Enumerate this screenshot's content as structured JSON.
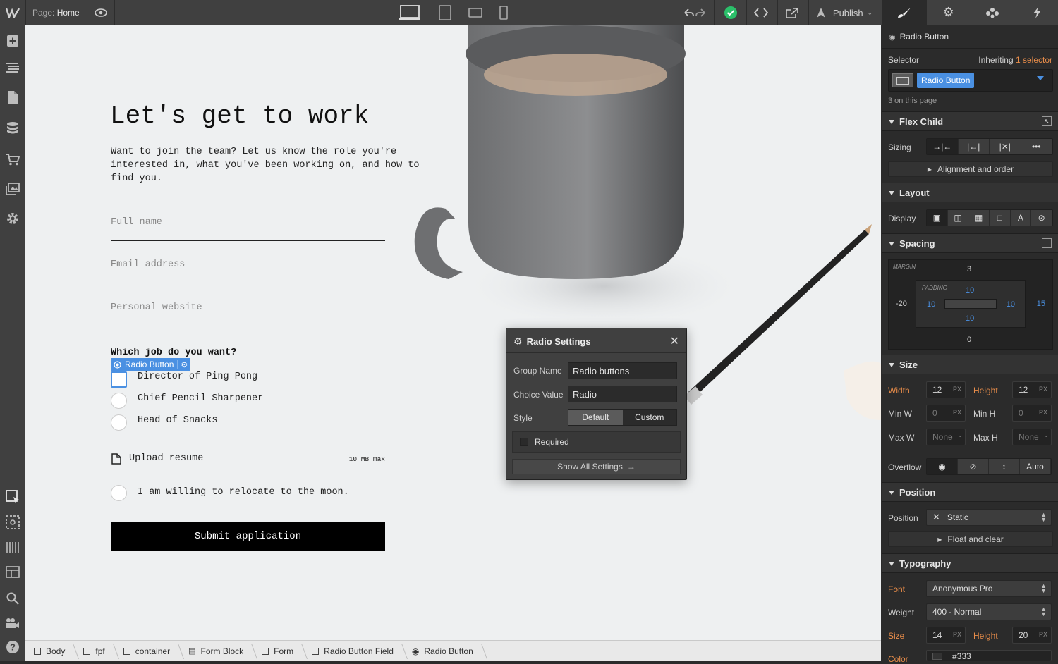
{
  "topbar": {
    "page_label": "Page:",
    "page_name": "Home",
    "publish_label": "Publish"
  },
  "canvas": {
    "heading": "Let's get to work",
    "intro": "Want to join the team? Let us know the role you're interested in, what you've been working on, and how to find you.",
    "fields": [
      {
        "placeholder": "Full name"
      },
      {
        "placeholder": "Email address"
      },
      {
        "placeholder": "Personal website"
      }
    ],
    "question": "Which job do you want?",
    "selection_tag": "Radio Button",
    "options": [
      "Director of Ping Pong",
      "Chief Pencil Sharpener",
      "Head of Snacks"
    ],
    "upload_label": "Upload resume",
    "upload_limit": "10 MB max",
    "relocate_label": "I am willing to relocate to the moon.",
    "submit_label": "Submit application"
  },
  "modal": {
    "title": "Radio Settings",
    "group_name_label": "Group Name",
    "group_name_value": "Radio buttons",
    "choice_value_label": "Choice Value",
    "choice_value_value": "Radio",
    "style_label": "Style",
    "style_options": [
      "Default",
      "Custom"
    ],
    "required_label": "Required",
    "show_all_label": "Show All Settings"
  },
  "breadcrumb": [
    "Body",
    "fpf",
    "container",
    "Form Block",
    "Form",
    "Radio Button Field",
    "Radio Button"
  ],
  "panel": {
    "element_type": "Radio Button",
    "selector_label": "Selector",
    "inheriting_label": "Inheriting",
    "inheriting_link": "1 selector",
    "selector_chip": "Radio Button",
    "on_page": "3 on this page",
    "flex_child": {
      "title": "Flex Child",
      "sizing_label": "Sizing",
      "sub": "Alignment and order"
    },
    "layout": {
      "title": "Layout",
      "display_label": "Display"
    },
    "spacing": {
      "title": "Spacing",
      "margin_label": "MARGIN",
      "padding_label": "PADDING",
      "margin_top": "3",
      "margin_left": "-20",
      "margin_right": "15",
      "margin_bottom": "0",
      "padding_top": "10",
      "padding_left": "10",
      "padding_right": "10",
      "padding_bottom": "10"
    },
    "size": {
      "title": "Size",
      "width_label": "Width",
      "width": "12",
      "width_unit": "PX",
      "height_label": "Height",
      "height": "12",
      "height_unit": "PX",
      "minw_label": "Min W",
      "minw": "0",
      "minw_unit": "PX",
      "minh_label": "Min H",
      "minh": "0",
      "minh_unit": "PX",
      "maxw_label": "Max W",
      "maxw": "None",
      "maxw_unit": "-",
      "maxh_label": "Max H",
      "maxh": "None",
      "maxh_unit": "-",
      "overflow_label": "Overflow",
      "overflow_auto": "Auto"
    },
    "position": {
      "title": "Position",
      "label": "Position",
      "value": "Static",
      "sub": "Float and clear"
    },
    "typography": {
      "title": "Typography",
      "font_label": "Font",
      "font": "Anonymous Pro",
      "weight_label": "Weight",
      "weight": "400 - Normal",
      "size_label": "Size",
      "size": "14",
      "size_unit": "PX",
      "lh_label": "Height",
      "lh": "20",
      "lh_unit": "PX",
      "color_label": "Color",
      "color": "#333"
    }
  },
  "colors": {
    "accent": "#4a90e2",
    "orange": "#e98d4a",
    "publish_ok": "#2bbf6a"
  }
}
